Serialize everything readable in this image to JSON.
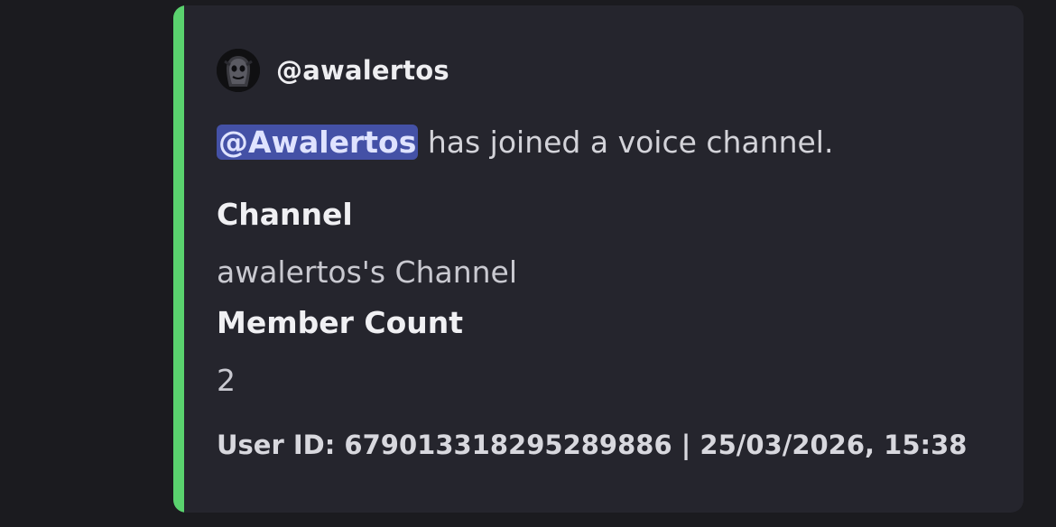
{
  "embed": {
    "accent_color": "#5ad26e",
    "author": {
      "avatar_icon": "ghost-avatar-icon",
      "name": "@awalertos"
    },
    "description": {
      "mention": "@Awalertos",
      "text": " has joined a voice channel."
    },
    "fields": [
      {
        "name": "Channel",
        "value": "awalertos's Channel"
      },
      {
        "name": "Member Count",
        "value": "2"
      }
    ],
    "footer": "User ID: 679013318295289886 | 25/03/2026, 15:38"
  }
}
